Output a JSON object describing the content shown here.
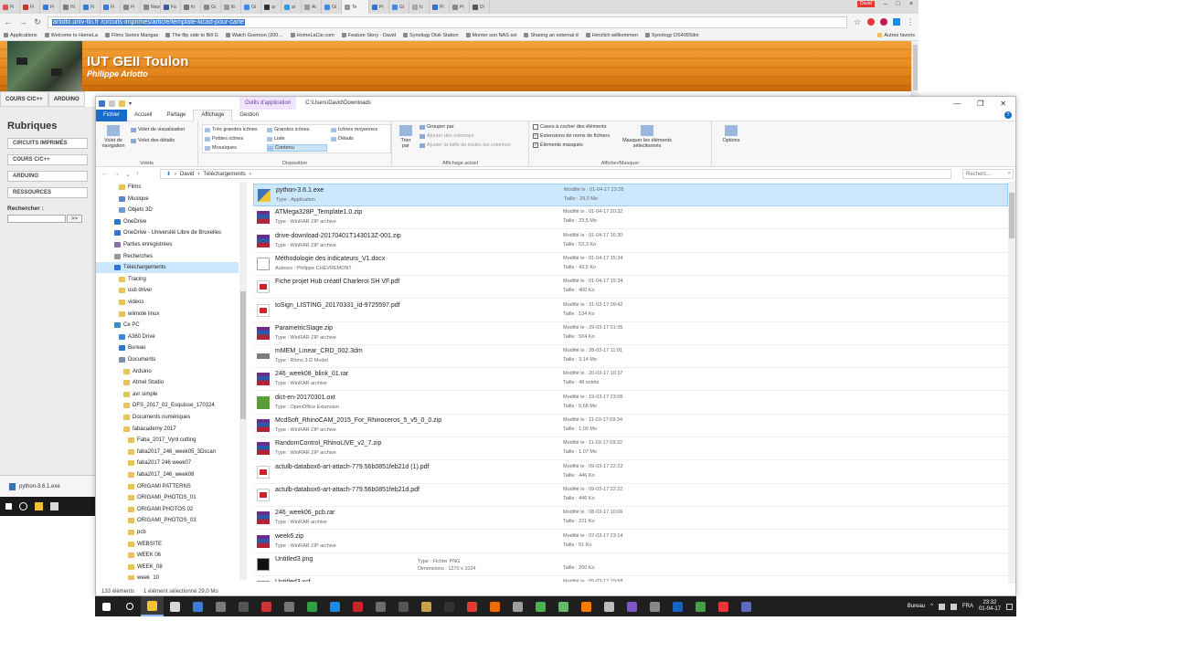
{
  "browser": {
    "tabs": [
      "Fi",
      "Fi",
      "Fi",
      "Hi",
      "Fi",
      "Fi",
      "Fi",
      "Nouv",
      "Fa",
      "fo",
      "Gi",
      "Ki",
      "Gi",
      "ar",
      "ar",
      "Ar",
      "Gi",
      "Te",
      "Pi",
      "Gi",
      "Ic",
      "Pi",
      "Pi",
      "Di"
    ],
    "user": "David",
    "window_controls": [
      "–",
      "□",
      "×"
    ],
    "url_prefix": "arlotto.univ-tln.fr",
    "url_path": "/circuits-imprimes/article/template-kicad-pour-carte",
    "bookmarks": [
      "Applications",
      "Welcome to HomeLa",
      "Films Series Mangas",
      "The flip side to Bill G",
      "Watch Goemon (200…",
      "HomeLaCie.com",
      "Feature Story - David",
      "Synology Disk Station",
      "Monter son NAS soi",
      "Sharing an external d",
      "Herzlich willkommen",
      "Synology DS409Slim"
    ],
    "bookmarks_other": "Autres favoris"
  },
  "site": {
    "title": "IUT GEII Toulon",
    "subtitle": "Philippe Arlotto",
    "nav_tabs": [
      "COURS C/C++",
      "ARDUINO"
    ],
    "rubriques_title": "Rubriques",
    "rubriques": [
      "CIRCUITS IMPRIMÉS",
      "COURS C/C++",
      "ARDUINO",
      "RESSOURCES"
    ],
    "search_label": "Rechercher :",
    "search_button": ">>",
    "download_file": "python-3.6.1.exe"
  },
  "explorer": {
    "context_tab": "Outils d'application",
    "title_path": "C:\\Users\\David\\Downloads",
    "win_buttons": [
      "—",
      "❐",
      "✕"
    ],
    "ribbon_tabs": [
      "Fichier",
      "Accueil",
      "Partage",
      "Affichage",
      "Gestion"
    ],
    "help": "?",
    "ribbon": {
      "volets_big": "Volet de navigation",
      "volets_items": [
        "Volet de visualisation",
        "Volet des détails"
      ],
      "volets_name": "Volets",
      "layout_items": [
        "Très grandes icônes",
        "Grandes icônes",
        "Icônes moyennes",
        "Petites icônes",
        "Liste",
        "Détails",
        "Mosaïques",
        "Contenu"
      ],
      "layout_name": "Disposition",
      "sort_big": "Trier par",
      "view_items": [
        "Grouper par",
        "Ajouter des colonnes",
        "Ajuster la taille de toutes les colonnes"
      ],
      "view_name": "Affichage actuel",
      "check_items": [
        {
          "label": "Cases à cocher des éléments",
          "checked": false
        },
        {
          "label": "Extensions de noms de fichiers",
          "checked": true
        },
        {
          "label": "Éléments masqués",
          "checked": true
        }
      ],
      "hide_big": "Masquer les éléments sélectionnés",
      "options_big": "Options",
      "show_name": "Afficher/Masquer"
    },
    "breadcrumb": [
      "David",
      "Téléchargements"
    ],
    "search_placeholder": "Recherc...",
    "nav_items": [
      {
        "label": "Films",
        "indent": 1,
        "color": "#e8c35a"
      },
      {
        "label": "Musique",
        "indent": 1,
        "color": "#5a86c8"
      },
      {
        "label": "Objets 3D",
        "indent": 1,
        "color": "#6a9ad6"
      },
      {
        "label": "OneDrive",
        "indent": 0,
        "color": "#2f74d0"
      },
      {
        "label": "OneDrive - Université Libre de Bruxelles",
        "indent": 0,
        "color": "#2f74d0"
      },
      {
        "label": "Parties enregistrées",
        "indent": 0,
        "color": "#8c6bb1"
      },
      {
        "label": "Recherches",
        "indent": 0,
        "color": "#999999"
      },
      {
        "label": "Téléchargements",
        "indent": 0,
        "color": "#2f74d0",
        "selected": true
      },
      {
        "label": "Tracing",
        "indent": 1,
        "color": "#e8c35a"
      },
      {
        "label": "usb driver",
        "indent": 1,
        "color": "#e8c35a"
      },
      {
        "label": "videos",
        "indent": 1,
        "color": "#e8c35a"
      },
      {
        "label": "wiimote linux",
        "indent": 1,
        "color": "#e8c35a"
      },
      {
        "label": "Ce PC",
        "indent": 0,
        "color": "#3a88d8"
      },
      {
        "label": "A360 Drive",
        "indent": 1,
        "color": "#3a88d8"
      },
      {
        "label": "Bureau",
        "indent": 1,
        "color": "#2f74d0"
      },
      {
        "label": "Documents",
        "indent": 1,
        "color": "#7a8ea8"
      },
      {
        "label": "Arduino",
        "indent": 2,
        "color": "#e8c35a"
      },
      {
        "label": "Atmel Studio",
        "indent": 2,
        "color": "#e8c35a"
      },
      {
        "label": "avr simple",
        "indent": 2,
        "color": "#e8c35a"
      },
      {
        "label": "DFS_2017_02_Esquisse_170324",
        "indent": 2,
        "color": "#e8c35a"
      },
      {
        "label": "Documents numériques",
        "indent": 2,
        "color": "#e8c35a"
      },
      {
        "label": "fabacademy 2017",
        "indent": 2,
        "color": "#e8c35a"
      },
      {
        "label": "Faba_2017_Vynl cutting",
        "indent": 3,
        "color": "#e8c35a"
      },
      {
        "label": "faba2017_246_week05_3Dscan",
        "indent": 3,
        "color": "#e8c35a"
      },
      {
        "label": "faba2017 246 week07",
        "indent": 3,
        "color": "#e8c35a"
      },
      {
        "label": "faba2017_246_week08",
        "indent": 3,
        "color": "#e8c35a"
      },
      {
        "label": "ORIGAMI PATTERNS",
        "indent": 3,
        "color": "#e8c35a"
      },
      {
        "label": "ORIGAMI_PHOTOS_01",
        "indent": 3,
        "color": "#e8c35a"
      },
      {
        "label": "ORIGAMI PHOTOS 02",
        "indent": 3,
        "color": "#e8c35a"
      },
      {
        "label": "ORIGAMI_PHOTOS_03",
        "indent": 3,
        "color": "#e8c35a"
      },
      {
        "label": "pcb",
        "indent": 3,
        "color": "#e8c35a"
      },
      {
        "label": "WEBSITE",
        "indent": 3,
        "color": "#e8c35a"
      },
      {
        "label": "WEEK 06",
        "indent": 3,
        "color": "#e8c35a"
      },
      {
        "label": "WEEK_08",
        "indent": 3,
        "color": "#e8c35a"
      },
      {
        "label": "week_10",
        "indent": 3,
        "color": "#e8c35a"
      }
    ],
    "files": [
      {
        "name": "python-3.6.1.exe",
        "type": "Type : Application",
        "date": "Modifié le : 01-04-17 23:28",
        "size": "Taille : 29,0 Mo",
        "icon": "exe",
        "selected": true
      },
      {
        "name": "ATMega328P_Template1.0.zip",
        "type": "Type : WinRAR ZIP archive",
        "date": "Modifié le : 01-04-17 20:32",
        "size": "Taille : 23,5 Mo",
        "icon": "rar"
      },
      {
        "name": "drive-download-20170401T143013Z-001.zip",
        "type": "Type : WinRAR ZIP archive",
        "date": "Modifié le : 01-04-17 16:30",
        "size": "Taille : 53,3 Ko",
        "icon": "rar"
      },
      {
        "name": "Méthodologie des indicateurs_V1.docx",
        "type": "Auteurs : Philippe CHEVREMONT",
        "date": "Modifié le : 01-04-17 15:34",
        "size": "Taille : 43,5 Ko",
        "icon": "doc"
      },
      {
        "name": "Fiche projet Hub créatif Charleroi SH VF.pdf",
        "type": "",
        "date": "Modifié le : 01-04-17 15:34",
        "size": "Taille : 400 Ko",
        "icon": "pdf"
      },
      {
        "name": "toSign_LISTING_20170331_id-9725597.pdf",
        "type": "",
        "date": "Modifié le : 31-03-17 09:42",
        "size": "Taille : 134 Ko",
        "icon": "pdf"
      },
      {
        "name": "ParametricStage.zip",
        "type": "Type : WinRAR ZIP archive",
        "date": "Modifié le : 29-03-17 01:05",
        "size": "Taille : 504 Ko",
        "icon": "rar"
      },
      {
        "name": "mMEM_Linear_CRD_002.3dm",
        "type": "Type : Rhino 3-D Model",
        "date": "Modifié le : 28-03-17 11:01",
        "size": "Taille : 3,14 Mo",
        "icon": "3dm"
      },
      {
        "name": "246_week08_blink_01.rar",
        "type": "Type : WinRAR archive",
        "date": "Modifié le : 20-03-17 10:37",
        "size": "Taille : 48 octets",
        "icon": "rar"
      },
      {
        "name": "dict-en-20170301.oxt",
        "type": "Type : OpenOffice Extension",
        "date": "Modifié le : 19-03-17 23:06",
        "size": "Taille : 5,68 Mo",
        "icon": "oxt"
      },
      {
        "name": "McdSoft_RhinoCAM_2015_For_Rhinoceros_5_v5_0_0.zip",
        "type": "Type : WinRAR ZIP archive",
        "date": "Modifié le : 11-03-17 09:34",
        "size": "Taille : 1,09 Mo",
        "icon": "rar"
      },
      {
        "name": "RandomControl_RhinoLIVE_v2_7.zip",
        "type": "Type : WinRAR ZIP archive",
        "date": "Modifié le : 11-03-17 09:32",
        "size": "Taille : 1,07 Mo",
        "icon": "rar"
      },
      {
        "name": "actulb-databox6-art-attach-779.56b0851feb21d (1).pdf",
        "type": "",
        "date": "Modifié le : 09-03-17 22:22",
        "size": "Taille : 446 Ko",
        "icon": "pdf"
      },
      {
        "name": "actulb-databox6-art-attach-779.56b0851feb21d.pdf",
        "type": "",
        "date": "Modifié le : 09-03-17 22:22",
        "size": "Taille : 446 Ko",
        "icon": "pdf"
      },
      {
        "name": "246_week06_pcb.rar",
        "type": "Type : WinRAR archive",
        "date": "Modifié le : 08-03-17 10:06",
        "size": "Taille : 221 Ko",
        "icon": "rar"
      },
      {
        "name": "week6.zip",
        "type": "Type : WinRAR ZIP archive",
        "date": "Modifié le : 07-03-17 23:14",
        "size": "Taille : 51 Ko",
        "icon": "rar"
      },
      {
        "name": "Untitled3.png",
        "type": "",
        "mid1": "Type : Fichier PNG",
        "mid2": "Dimensions : 1270 x 1024",
        "date": "",
        "size": "Taille : 200 Ko",
        "icon": "png"
      },
      {
        "name": "Untitled3.xcf",
        "type": "",
        "date": "Modifié le : 05-03-17 19:58",
        "size": "",
        "icon": "xcf"
      }
    ],
    "status_count": "133 éléments",
    "status_selected": "1 élément sélectionné  29,0 Mo"
  },
  "taskbar": {
    "apps": [
      "#f1c232",
      "#d9d9d9",
      "#3d7bd9",
      "#7a7a7a",
      "#555",
      "#cc3333",
      "#777",
      "#2ea043",
      "#1e88e5",
      "#c62828",
      "#6d6d6d",
      "#555",
      "#c8a14a",
      "#333",
      "#e53935",
      "#ef6c00",
      "#9e9e9e",
      "#4caf50",
      "#66bb6a",
      "#f57c00",
      "#bdbdbd",
      "#7e57c2",
      "#888",
      "#1565c0",
      "#43a047",
      "#e53935",
      "#5c6bc0"
    ],
    "desktop_label": "Bureau",
    "time": "23:32",
    "date": "01-04-17",
    "lang": "FRA"
  }
}
